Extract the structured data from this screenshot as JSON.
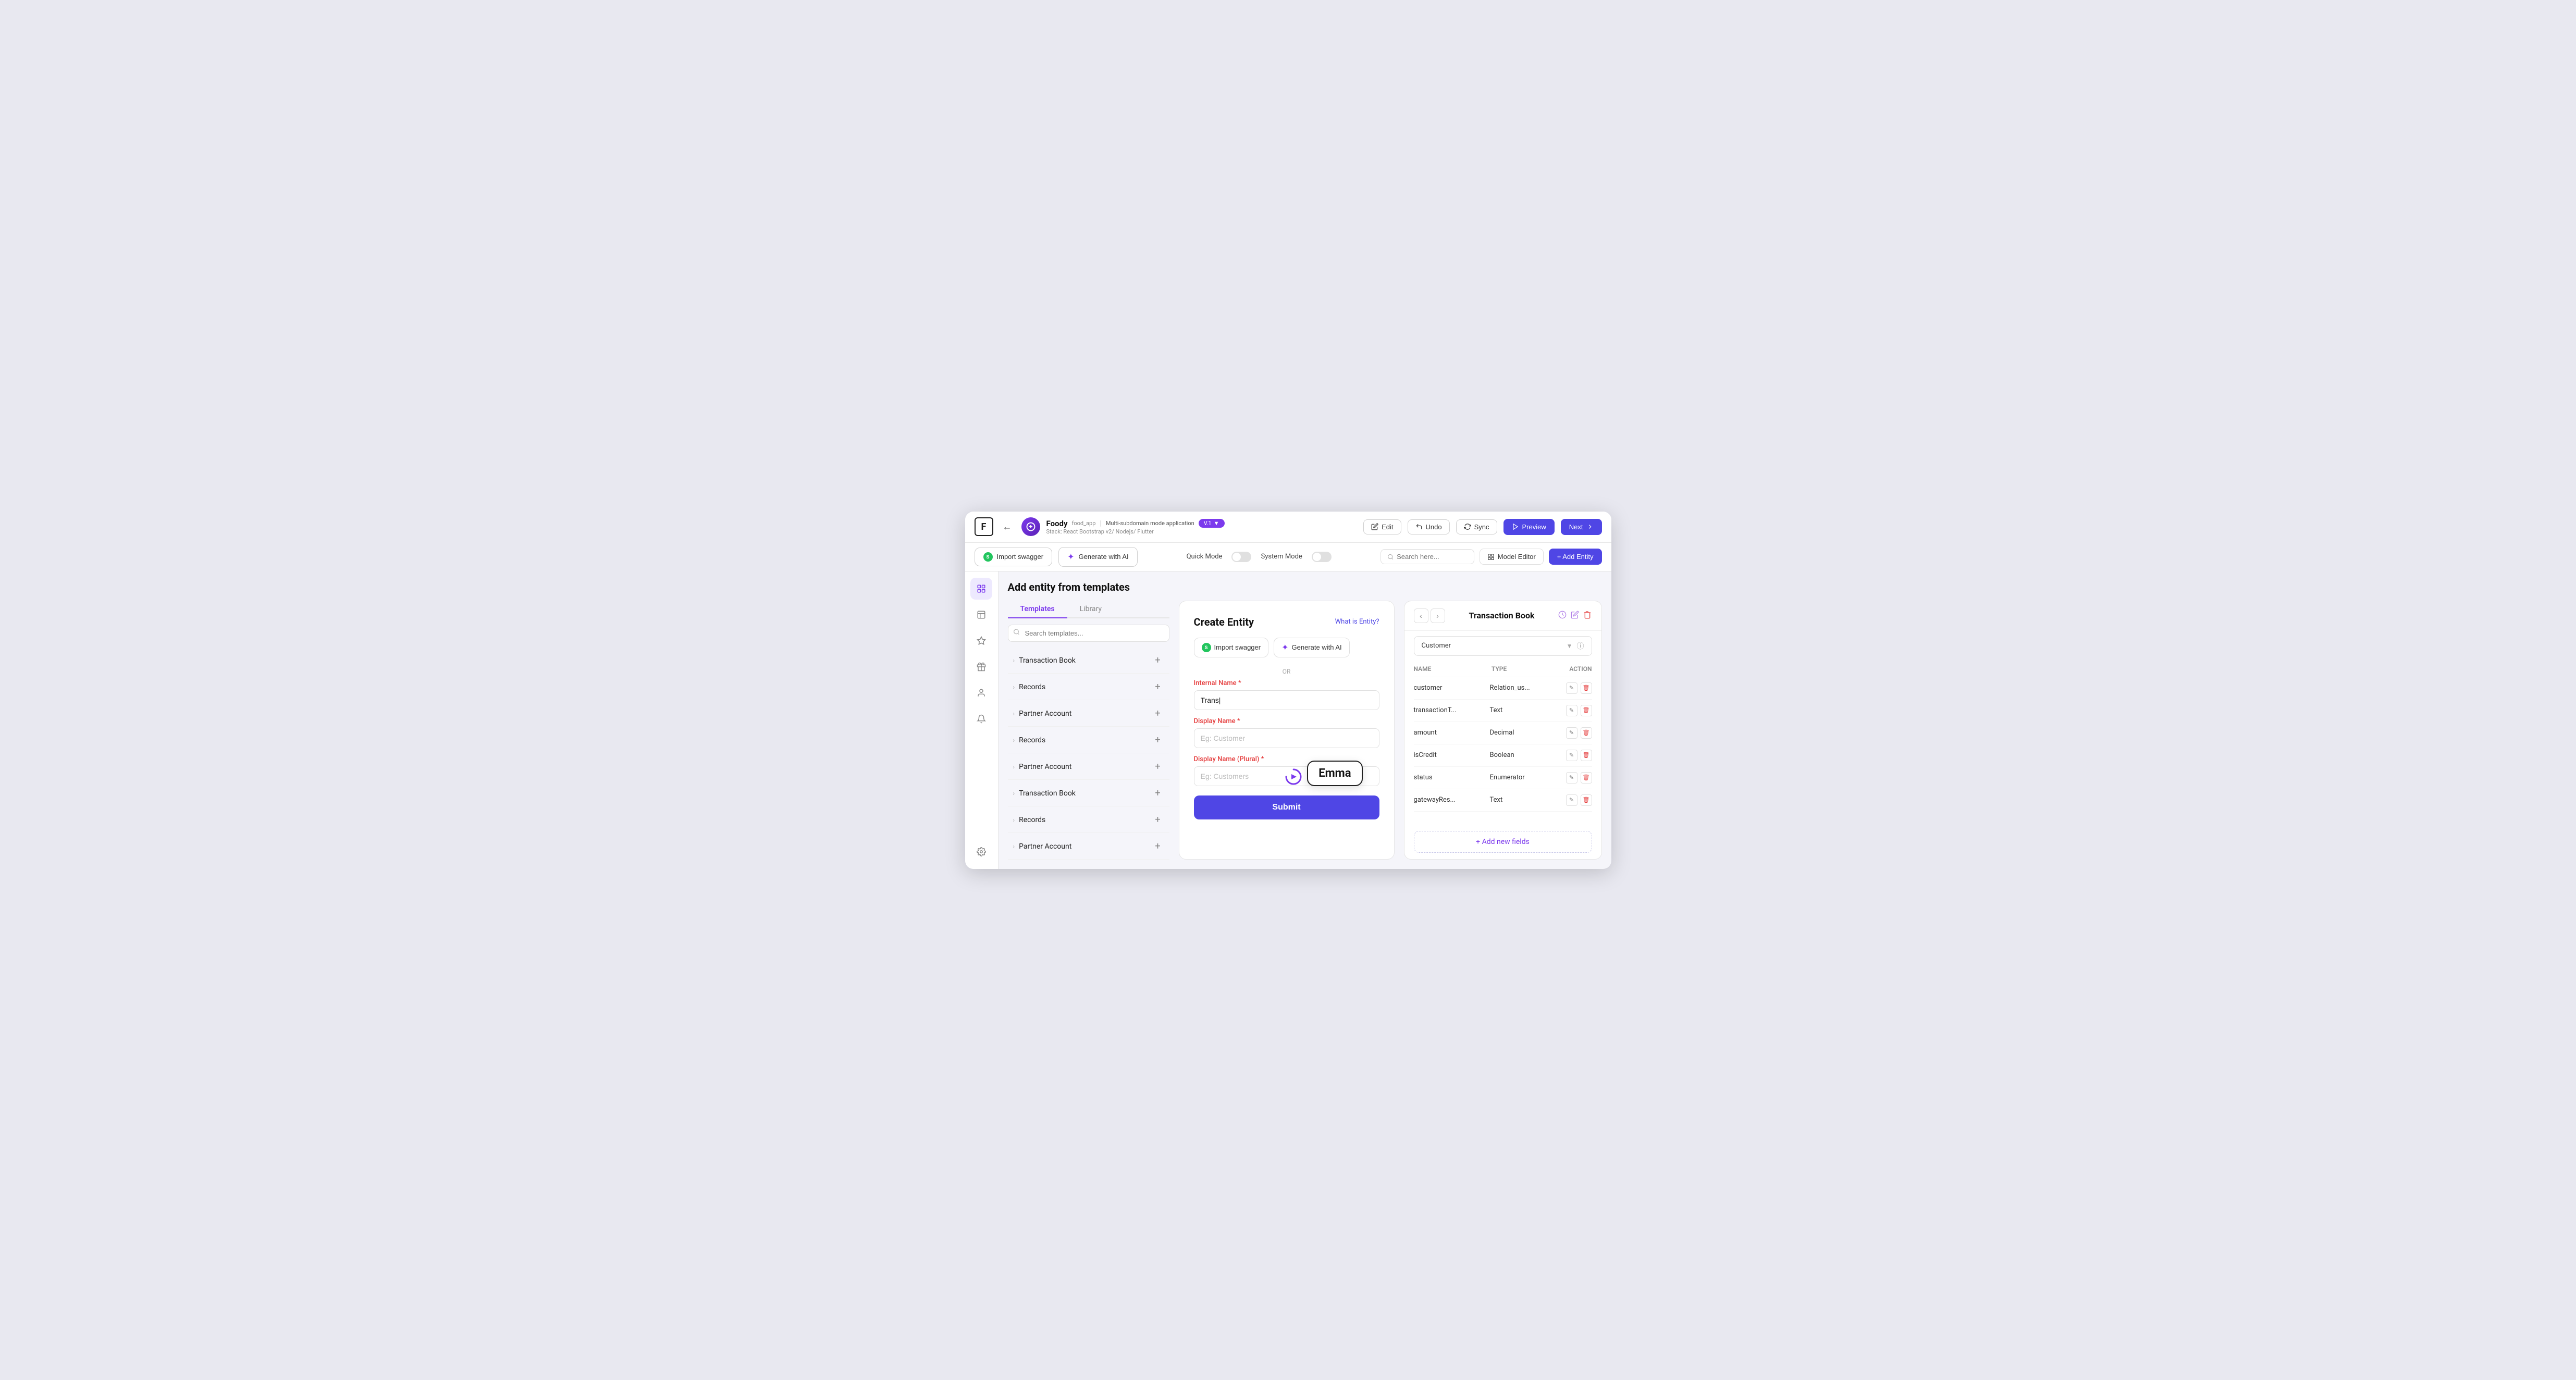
{
  "app": {
    "logo": "F",
    "name": "Foody",
    "food_app_tag": "food_app",
    "separator": "|",
    "multi_subdomain": "Multi-subdomain mode application",
    "stack": "Stack: React Bootstrap v2/ Nodejs/ Flutter",
    "version": "V.1"
  },
  "topbar": {
    "edit_label": "Edit",
    "undo_label": "Undo",
    "sync_label": "Sync",
    "preview_label": "Preview",
    "next_label": "Next"
  },
  "content_header": {
    "import_swagger_label": "Import swagger",
    "generate_ai_label": "Generate with AI",
    "or_text": "OR",
    "quick_mode_label": "Quick Mode",
    "system_mode_label": "System Mode",
    "search_placeholder": "Search here...",
    "model_editor_label": "Model Editor",
    "add_entity_label": "+ Add Entity"
  },
  "templates_panel": {
    "title": "Add entity from templates",
    "tab_templates": "Templates",
    "tab_library": "Library",
    "search_placeholder": "Search templates...",
    "items": [
      {
        "name": "Transaction Book"
      },
      {
        "name": "Records"
      },
      {
        "name": "Partner Account"
      },
      {
        "name": "Records"
      },
      {
        "name": "Partner Account"
      },
      {
        "name": "Transaction Book"
      },
      {
        "name": "Records"
      },
      {
        "name": "Partner Account"
      }
    ]
  },
  "create_entity": {
    "title": "Create Entity",
    "what_is_entity": "What is Entity?",
    "import_swagger_label": "Import swagger",
    "generate_ai_label": "Generate with AI",
    "or_text": "OR",
    "internal_name_label": "Internal Name",
    "internal_name_required": "*",
    "internal_name_value": "Trans|",
    "display_name_label": "Display Name",
    "display_name_required": "*",
    "display_name_placeholder": "Eg: Customer",
    "display_name_plural_label": "Display Name (Plural)",
    "display_name_plural_required": "*",
    "display_name_plural_placeholder": "Eg: Customers",
    "submit_label": "Submit",
    "cursor_label": "Emma"
  },
  "transaction_book": {
    "title": "Transaction Book",
    "dropdown_value": "Customer",
    "table_headers": {
      "name": "Name",
      "type": "Type",
      "action": "Action"
    },
    "rows": [
      {
        "name": "customer",
        "type": "Relation_us..."
      },
      {
        "name": "transactionT...",
        "type": "Text"
      },
      {
        "name": "amount",
        "type": "Decimal"
      },
      {
        "name": "isCredit",
        "type": "Boolean"
      },
      {
        "name": "status",
        "type": "Enumerator"
      },
      {
        "name": "gatewayRes...",
        "type": "Text"
      }
    ],
    "add_fields_label": "+ Add new fields"
  },
  "nav_items": [
    {
      "icon": "⊞",
      "name": "grid-icon",
      "active": true
    },
    {
      "icon": "⊟",
      "name": "dashboard-icon",
      "active": false
    },
    {
      "icon": "★",
      "name": "star-icon",
      "active": false
    },
    {
      "icon": "🎁",
      "name": "gift-icon",
      "active": false
    },
    {
      "icon": "👤",
      "name": "user-icon",
      "active": false
    },
    {
      "icon": "🔔",
      "name": "bell-icon",
      "active": false
    },
    {
      "icon": "⚙",
      "name": "settings-icon",
      "active": false
    }
  ],
  "colors": {
    "primary": "#4f46e5",
    "accent": "#7c3aed",
    "danger": "#e53e3e",
    "success": "#22c55e"
  }
}
